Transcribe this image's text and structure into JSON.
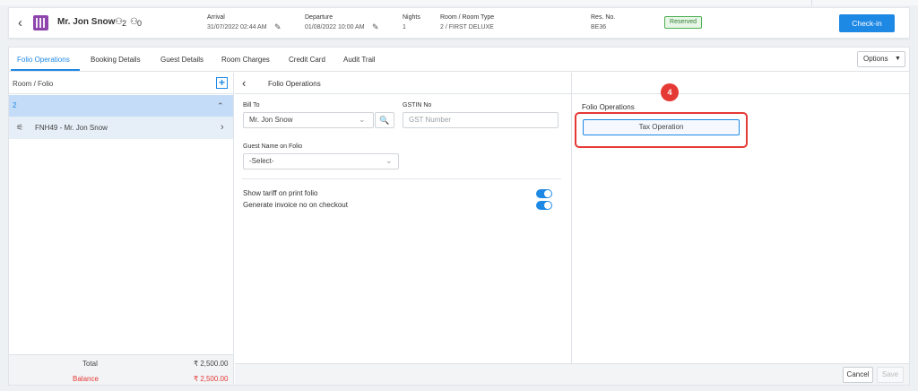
{
  "header": {
    "guest_name": "Mr. Jon Snow",
    "adults": "2",
    "children": "0",
    "arrival_label": "Arrival",
    "arrival_value": "31/07/2022 02:44 AM",
    "departure_label": "Departure",
    "departure_value": "01/08/2022 10:00 AM",
    "nights_label": "Nights",
    "nights_value": "1",
    "room_label": "Room / Room Type",
    "room_value": "2 / FIRST DELUXE",
    "resno_label": "Res. No.",
    "resno_value": "BE36",
    "status": "Reserved",
    "checkin_label": "Check-in"
  },
  "tabs": [
    "Folio Operations",
    "Booking Details",
    "Guest Details",
    "Room Charges",
    "Credit Card",
    "Audit Trail"
  ],
  "options_label": "Options",
  "left": {
    "title": "Room / Folio",
    "room_number": "2",
    "folio": "FNH49 - Mr. Jon Snow",
    "total_label": "Total",
    "total_value": "₹ 2,500.00",
    "balance_label": "Balance",
    "balance_value": "₹ 2,500.00"
  },
  "middle": {
    "title": "Folio Operations",
    "bill_to_label": "Bill To",
    "bill_to_value": "Mr. Jon Snow",
    "gstin_label": "GSTIN No",
    "gstin_placeholder": "GST Number",
    "guest_name_label": "Guest Name on Folio",
    "guest_name_value": "-Select-",
    "toggle1_label": "Show tariff on print folio",
    "toggle2_label": "Generate invoice no on checkout"
  },
  "right": {
    "title": "Folio Operations",
    "tax_button": "Tax Operation",
    "step": "4"
  },
  "footer": {
    "cancel": "Cancel",
    "save": "Save"
  },
  "colors": {
    "accent": "#1e88e5",
    "highlight": "#e53935",
    "status_green": "#4caf50"
  }
}
